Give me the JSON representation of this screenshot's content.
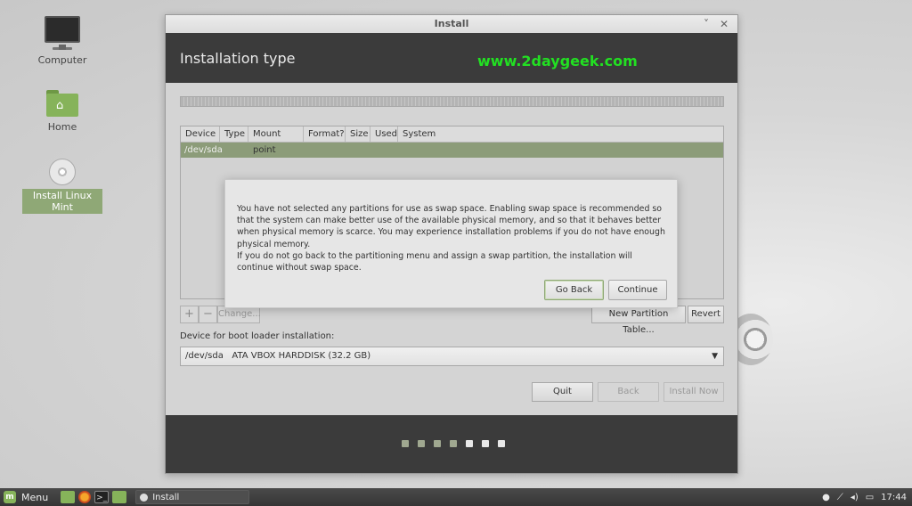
{
  "desktop": {
    "icons": [
      {
        "label": "Computer"
      },
      {
        "label": "Home"
      },
      {
        "label": "Install Linux Mint"
      }
    ]
  },
  "window": {
    "title": "Install",
    "minimize": "˅",
    "close": "✕",
    "header_title": "Installation type",
    "watermark": "www.2daygeek.com",
    "table": {
      "columns": [
        "Device",
        "Type",
        "Mount point",
        "Format?",
        "Size",
        "Used",
        "System"
      ],
      "rows": [
        "/dev/sda"
      ]
    },
    "table_buttons": {
      "add": "+",
      "remove": "−",
      "change": "Change...",
      "new_partition_table": "New Partition Table...",
      "revert": "Revert"
    },
    "boot_label": "Device for boot loader installation:",
    "boot_device": "/dev/sda   ATA VBOX HARDDISK (32.2 GB)",
    "buttons": {
      "quit": "Quit",
      "back": "Back",
      "install_now": "Install Now"
    },
    "progress": {
      "total_steps": 7,
      "current_step": 7
    }
  },
  "dialog": {
    "paragraph1": "You have not selected any partitions for use as swap space. Enabling swap space is recommended so that the system can make better use of the available physical memory, and so that it behaves better when physical memory is scarce. You may experience installation problems if you do not have enough physical memory.",
    "paragraph2": "If you do not go back to the partitioning menu and assign a swap partition, the installation will continue without swap space.",
    "go_back": "Go Back",
    "continue": "Continue"
  },
  "taskbar": {
    "menu_label": "Menu",
    "task_label": "Install",
    "clock": "17:44"
  },
  "colors": {
    "accent": "#8fa876",
    "watermark": "#22e022",
    "header_bg": "#3b3b3b"
  }
}
